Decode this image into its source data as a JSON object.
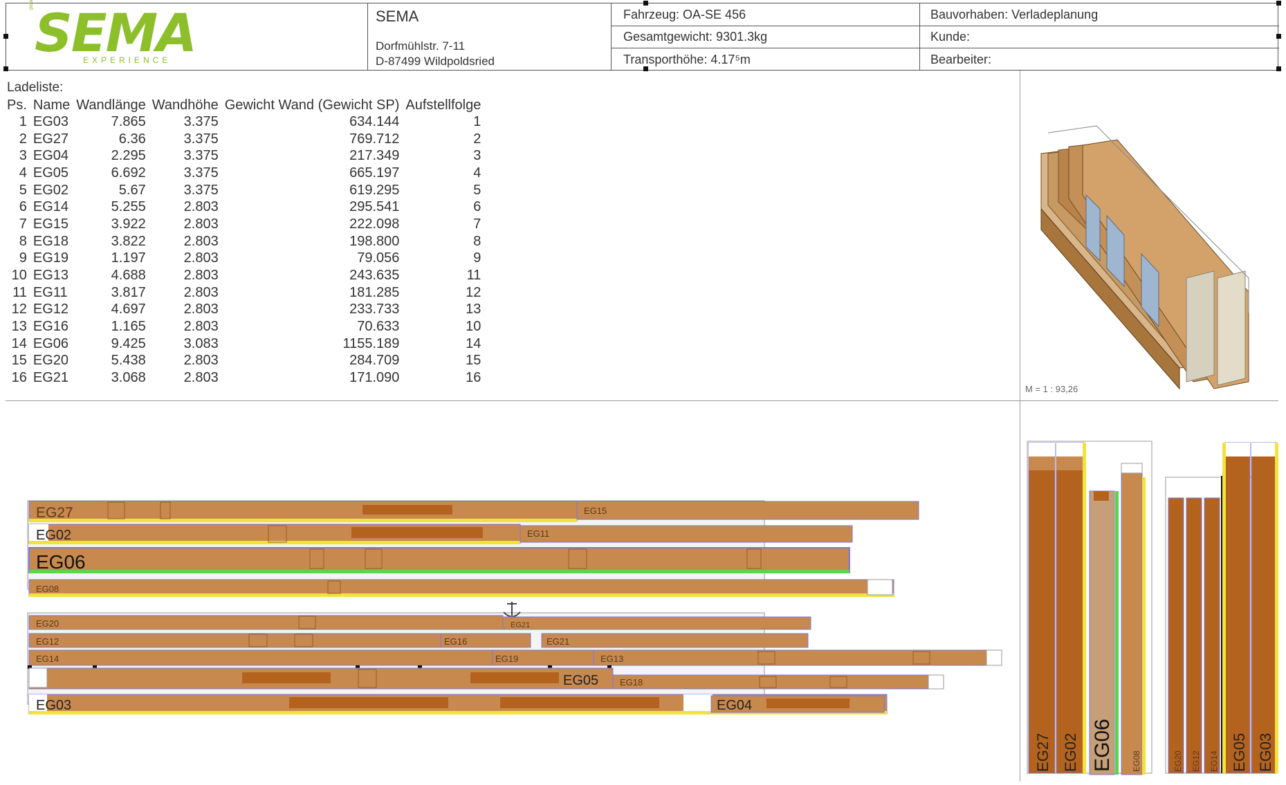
{
  "logo": {
    "wordmark": "SEMA",
    "tagline": "EXPERIENCE",
    "powered": "powered by"
  },
  "company": {
    "name": "SEMA",
    "street": "Dorfmühlstr. 7-11",
    "city": "D-87499 Wildpoldsried"
  },
  "vehicle": {
    "fahrzeug": "Fahrzeug: OA-SE 456",
    "gewicht": "Gesamtgewicht: 9301.3kg",
    "hoehe": "Transporthöhe: 4.17⁵m"
  },
  "project": {
    "bauvorhaben": "Bauvorhaben: Verladeplanung",
    "kunde": "Kunde:",
    "bearbeiter": "Bearbeiter:"
  },
  "ladeliste": {
    "title": "Ladeliste:",
    "headers": [
      "Ps.",
      "Name",
      "Wandlänge",
      "Wandhöhe",
      "Gewicht Wand (Gewicht SP)",
      "Aufstellfolge"
    ],
    "rows": [
      [
        "1",
        "EG03",
        "7.865",
        "3.375",
        "634.144",
        "1"
      ],
      [
        "2",
        "EG27",
        "6.36",
        "3.375",
        "769.712",
        "2"
      ],
      [
        "3",
        "EG04",
        "2.295",
        "3.375",
        "217.349",
        "3"
      ],
      [
        "4",
        "EG05",
        "6.692",
        "3.375",
        "665.197",
        "4"
      ],
      [
        "5",
        "EG02",
        "5.67",
        "3.375",
        "619.295",
        "5"
      ],
      [
        "6",
        "EG14",
        "5.255",
        "2.803",
        "295.541",
        "6"
      ],
      [
        "7",
        "EG15",
        "3.922",
        "2.803",
        "222.098",
        "7"
      ],
      [
        "8",
        "EG18",
        "3.822",
        "2.803",
        "198.800",
        "8"
      ],
      [
        "9",
        "EG19",
        "1.197",
        "2.803",
        "79.056",
        "9"
      ],
      [
        "10",
        "EG13",
        "4.688",
        "2.803",
        "243.635",
        "11"
      ],
      [
        "11",
        "EG11",
        "3.817",
        "2.803",
        "181.285",
        "12"
      ],
      [
        "12",
        "EG12",
        "4.697",
        "2.803",
        "233.733",
        "13"
      ],
      [
        "13",
        "EG16",
        "1.165",
        "2.803",
        "70.633",
        "10"
      ],
      [
        "14",
        "EG06",
        "9.425",
        "3.083",
        "1155.189",
        "14"
      ],
      [
        "15",
        "EG20",
        "5.438",
        "2.803",
        "284.709",
        "15"
      ],
      [
        "16",
        "EG21",
        "3.068",
        "2.803",
        "171.090",
        "16"
      ]
    ]
  },
  "view3d": {
    "scale": "M = 1 : 93,26"
  },
  "plan_labels": {
    "eg27": "EG27",
    "eg15": "EG15",
    "eg02": "EG02",
    "eg11": "EG11",
    "eg06": "EG06",
    "eg08": "EG08",
    "eg20": "EG20",
    "eg21a": "EG21",
    "eg12": "EG12",
    "eg16": "EG16",
    "eg21b": "EG21",
    "eg14": "EG14",
    "eg19": "EG19",
    "eg13": "EG13",
    "eg05": "EG05",
    "eg18": "EG18",
    "eg03": "EG03",
    "eg04": "EG04"
  },
  "side_labels": [
    "EG27",
    "EG02",
    "EG06",
    "EG08",
    "EG20",
    "EG12",
    "EG14",
    "EG05",
    "EG03"
  ],
  "colors": {
    "wall": "#c8894f",
    "wall_dark": "#b4631f",
    "yellow": "#f2e23c",
    "green": "#5bd64a",
    "blue": "#7b78d8",
    "logo": "#8cbf2a"
  }
}
